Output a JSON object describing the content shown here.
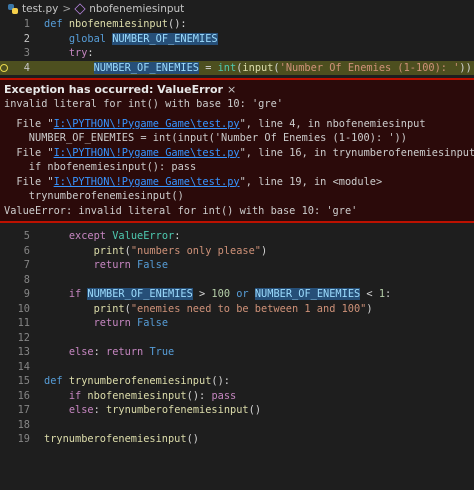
{
  "breadcrumb": {
    "file": "test.py",
    "separator": ">",
    "symbol": "nbofenemiesinput"
  },
  "lines": {
    "l1": {
      "num": "1",
      "def_kw": "def",
      "name": "nbofenemiesinput",
      "punct": "():"
    },
    "l2": {
      "num": "2",
      "global_kw": "global",
      "var": "NUMBER_OF_ENEMIES"
    },
    "l3": {
      "num": "3",
      "try_kw": "try",
      "colon": ":"
    },
    "l4": {
      "num": "4",
      "var": "NUMBER_OF_ENEMIES",
      "assign": " = ",
      "int_fn": "int",
      "p1": "(",
      "input_fn": "input",
      "p2": "(",
      "str": "'Number Of Enemies (1-100): '",
      "p3": "))"
    },
    "l5": {
      "num": "5",
      "except_kw": "except",
      "cls": "ValueError",
      "colon": ":"
    },
    "l6": {
      "num": "6",
      "print_fn": "print",
      "p1": "(",
      "str": "\"numbers only please\"",
      "p2": ")"
    },
    "l7": {
      "num": "7",
      "return_kw": "return",
      "val": "False"
    },
    "l8": {
      "num": "8"
    },
    "l9": {
      "num": "9",
      "if_kw": "if",
      "var1": "NUMBER_OF_ENEMIES",
      "gt": " > ",
      "n1": "100",
      "or_kw": "or",
      "var2": "NUMBER_OF_ENEMIES",
      "lt": " < ",
      "n2": "1",
      "colon": ":"
    },
    "l10": {
      "num": "10",
      "print_fn": "print",
      "p1": "(",
      "str": "\"enemies need to be between 1 and 100\"",
      "p2": ")"
    },
    "l11": {
      "num": "11",
      "return_kw": "return",
      "val": "False"
    },
    "l12": {
      "num": "12"
    },
    "l13": {
      "num": "13",
      "else_kw": "else",
      "colon": ": ",
      "return_kw": "return",
      "val": "True"
    },
    "l14": {
      "num": "14"
    },
    "l15": {
      "num": "15",
      "def_kw": "def",
      "name": "trynumberofenemiesinput",
      "punct": "():"
    },
    "l16": {
      "num": "16",
      "if_kw": "if",
      "fn": "nbofenemiesinput",
      "punct": "(): ",
      "pass_kw": "pass"
    },
    "l17": {
      "num": "17",
      "else_kw": "else",
      "colon": ": ",
      "fn": "trynumberofenemiesinput",
      "punct": "()"
    },
    "l18": {
      "num": "18"
    },
    "l19": {
      "num": "19",
      "fn": "trynumberofenemiesinput",
      "punct": "()"
    }
  },
  "exception": {
    "title": "Exception has occurred: ValueError",
    "close_glyph": "×",
    "message": "invalid literal for int() with base 10: 'gre'",
    "tb1_pre": "  File \"",
    "tb1_path": "I:\\PYTHON\\!Pygame Game\\test.py",
    "tb1_post": "\", line 4, in nbofenemiesinput",
    "tb1_code": "    NUMBER_OF_ENEMIES = int(input('Number Of Enemies (1-100): '))",
    "tb2_pre": "  File \"",
    "tb2_path": "I:\\PYTHON\\!Pygame Game\\test.py",
    "tb2_post": "\", line 16, in trynumberofenemiesinput",
    "tb2_code": "    if nbofenemiesinput(): pass",
    "tb3_pre": "  File \"",
    "tb3_path": "I:\\PYTHON\\!Pygame Game\\test.py",
    "tb3_post": "\", line 19, in <module>",
    "tb3_code": "    trynumberofenemiesinput()",
    "final": "ValueError: invalid literal for int() with base 10: 'gre'"
  },
  "colors": {
    "exception_border": "#be1100",
    "exception_bg": "#2b0a0a",
    "current_line_bg": "#4d4f1f",
    "link": "#3794ff"
  }
}
